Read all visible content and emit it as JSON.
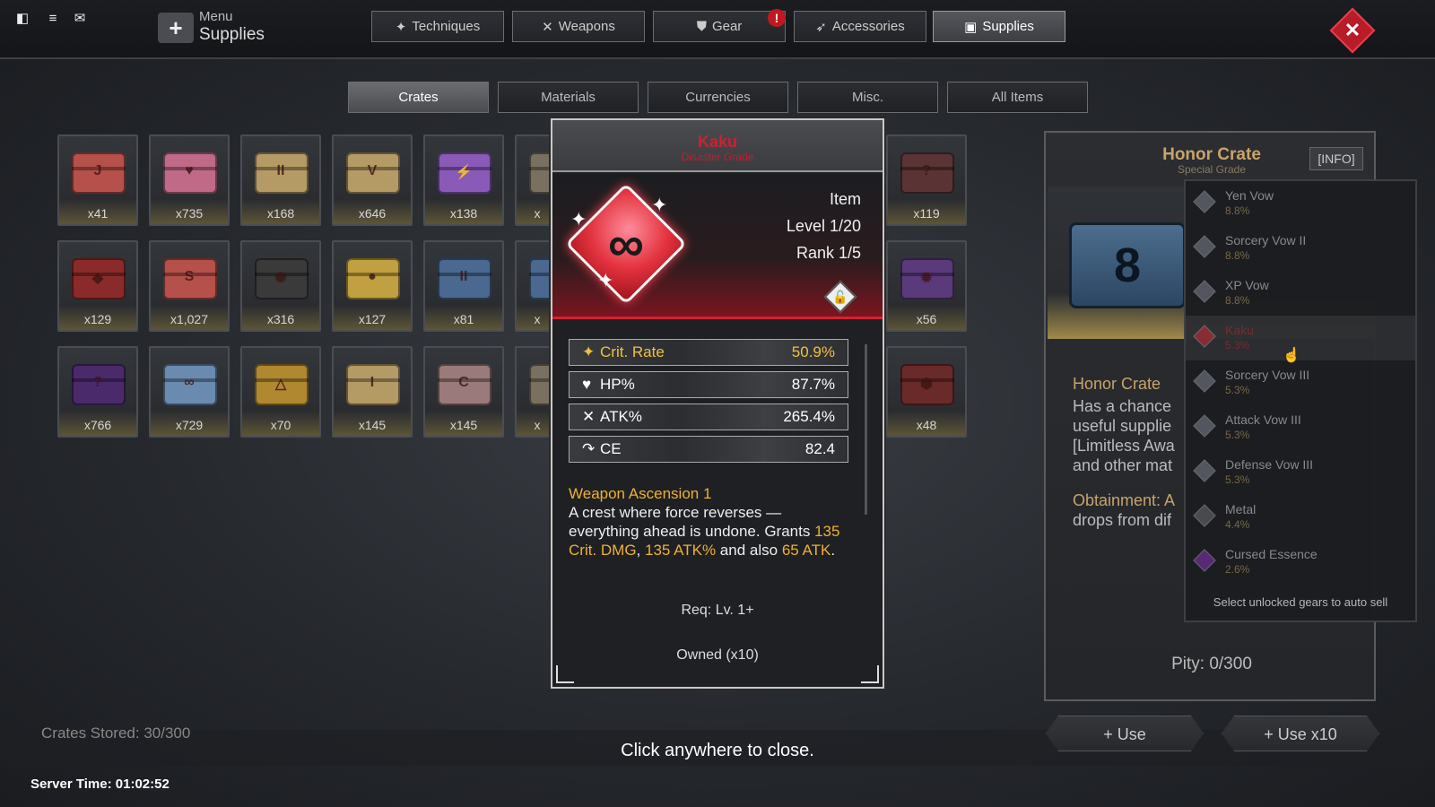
{
  "topbar": {
    "menu_label": "Menu",
    "menu_sub": "Supplies",
    "tabs": [
      {
        "icon": "✦",
        "label": "Techniques"
      },
      {
        "icon": "✕",
        "label": "Weapons"
      },
      {
        "icon": "⛊",
        "label": "Gear"
      },
      {
        "icon": "➶",
        "label": "Accessories"
      },
      {
        "icon": "▣",
        "label": "Supplies"
      }
    ],
    "gear_alert": "!",
    "close": "✕"
  },
  "subtabs": [
    "Crates",
    "Materials",
    "Currencies",
    "Misc.",
    "All Items"
  ],
  "crates": {
    "row1": [
      "x41",
      "x735",
      "x168",
      "x646",
      "x138",
      "x",
      "x119"
    ],
    "row2": [
      "x129",
      "x1,027",
      "x316",
      "x127",
      "x81",
      "x",
      "x56"
    ],
    "row3": [
      "x766",
      "x729",
      "x70",
      "x145",
      "x145",
      "x",
      "x48"
    ],
    "marks": {
      "row1": [
        "J",
        "♥",
        "II",
        "V",
        "⚡",
        "",
        "?"
      ],
      "row2": [
        "◆",
        "S",
        "✺",
        "●",
        "II",
        "",
        "✹"
      ],
      "row3": [
        "?",
        "∞",
        "△",
        "I",
        "C",
        "",
        "⬢"
      ]
    },
    "colors": {
      "row1": [
        "#b5504a",
        "#c06a88",
        "#b49a64",
        "#b49a64",
        "#8a5ab8",
        "#7a7060",
        "#5a3434"
      ],
      "row2": [
        "#8a2a2a",
        "#b5504a",
        "#3a3a3a",
        "#c0a040",
        "#4a6890",
        "#4a6890",
        "#5a3a7a"
      ],
      "row3": [
        "#4a2a6a",
        "#6a8ab0",
        "#b08830",
        "#b49a64",
        "#9a7a7a",
        "#7a7060",
        "#6a2a2a"
      ]
    }
  },
  "modal": {
    "name": "Kaku",
    "grade": "Disaster Grade",
    "gem_symbol": "∞",
    "type": "Item",
    "level": "Level 1/20",
    "rank": "Rank 1/5",
    "lock_icon": "🔓",
    "stats": [
      {
        "icon": "✦",
        "name": "Crit. Rate",
        "value": "50.9%"
      },
      {
        "icon": "♥",
        "name": "HP%",
        "value": "87.7%"
      },
      {
        "icon": "✕",
        "name": "ATK%",
        "value": "265.4%"
      },
      {
        "icon": "↷",
        "name": "CE",
        "value": "82.4"
      }
    ],
    "ascension": "Weapon Ascension 1",
    "desc_a": "A crest where force reverses — everything ahead is undone. Grants ",
    "desc_b": "135 Crit. DMG",
    "desc_c": ", ",
    "desc_d": "135 ATK%",
    "desc_e": " and also ",
    "desc_f": "65 ATK",
    "desc_g": ".",
    "req": "Req: Lv. 1+",
    "owned": "Owned (x10)"
  },
  "right_panel": {
    "title": "Honor Crate",
    "subtitle": "Special Grade",
    "info": "[INFO]",
    "name": "Honor Crate",
    "desc": "Has a chance\nuseful supplie\n[Limitless Awa\nand other mat",
    "obtainment": "Obtainment: A",
    "obtainment2": "drops from dif",
    "pity": "Pity: 0/300",
    "chest_symbol": "8"
  },
  "dropdown": {
    "items": [
      {
        "name": "Yen Vow",
        "pct": "8.8%"
      },
      {
        "name": "Sorcery Vow II",
        "pct": "8.8%"
      },
      {
        "name": "XP Vow",
        "pct": "8.8%"
      },
      {
        "name": "Kaku",
        "pct": "5.3%"
      },
      {
        "name": "Sorcery Vow III",
        "pct": "5.3%"
      },
      {
        "name": "Attack Vow III",
        "pct": "5.3%"
      },
      {
        "name": "Defense Vow III",
        "pct": "5.3%"
      },
      {
        "name": "Metal",
        "pct": "4.4%"
      },
      {
        "name": "Cursed Essence",
        "pct": "2.6%"
      }
    ],
    "footer": "Select unlocked gears to auto sell"
  },
  "buttons": {
    "use": "+ Use",
    "use10": "+ Use x10"
  },
  "footer": {
    "crates_stored": "Crates Stored: 30/300",
    "click_close": "Click anywhere to close.",
    "server_time": "Server Time: 01:02:52"
  }
}
